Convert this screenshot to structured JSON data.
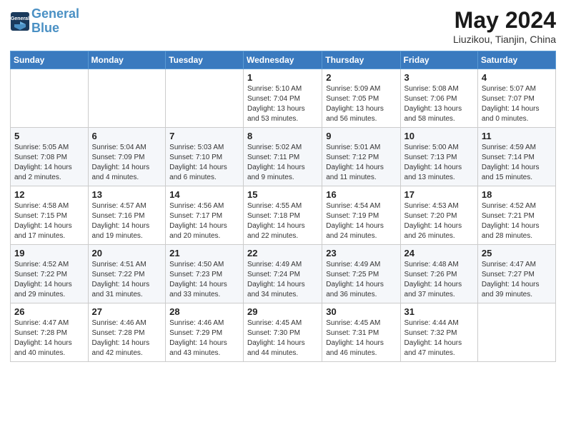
{
  "header": {
    "logo_line1": "General",
    "logo_line2": "Blue",
    "month_year": "May 2024",
    "location": "Liuzikou, Tianjin, China"
  },
  "weekdays": [
    "Sunday",
    "Monday",
    "Tuesday",
    "Wednesday",
    "Thursday",
    "Friday",
    "Saturday"
  ],
  "weeks": [
    [
      {
        "day": "",
        "info": ""
      },
      {
        "day": "",
        "info": ""
      },
      {
        "day": "",
        "info": ""
      },
      {
        "day": "1",
        "info": "Sunrise: 5:10 AM\nSunset: 7:04 PM\nDaylight: 13 hours and 53 minutes."
      },
      {
        "day": "2",
        "info": "Sunrise: 5:09 AM\nSunset: 7:05 PM\nDaylight: 13 hours and 56 minutes."
      },
      {
        "day": "3",
        "info": "Sunrise: 5:08 AM\nSunset: 7:06 PM\nDaylight: 13 hours and 58 minutes."
      },
      {
        "day": "4",
        "info": "Sunrise: 5:07 AM\nSunset: 7:07 PM\nDaylight: 14 hours and 0 minutes."
      }
    ],
    [
      {
        "day": "5",
        "info": "Sunrise: 5:05 AM\nSunset: 7:08 PM\nDaylight: 14 hours and 2 minutes."
      },
      {
        "day": "6",
        "info": "Sunrise: 5:04 AM\nSunset: 7:09 PM\nDaylight: 14 hours and 4 minutes."
      },
      {
        "day": "7",
        "info": "Sunrise: 5:03 AM\nSunset: 7:10 PM\nDaylight: 14 hours and 6 minutes."
      },
      {
        "day": "8",
        "info": "Sunrise: 5:02 AM\nSunset: 7:11 PM\nDaylight: 14 hours and 9 minutes."
      },
      {
        "day": "9",
        "info": "Sunrise: 5:01 AM\nSunset: 7:12 PM\nDaylight: 14 hours and 11 minutes."
      },
      {
        "day": "10",
        "info": "Sunrise: 5:00 AM\nSunset: 7:13 PM\nDaylight: 14 hours and 13 minutes."
      },
      {
        "day": "11",
        "info": "Sunrise: 4:59 AM\nSunset: 7:14 PM\nDaylight: 14 hours and 15 minutes."
      }
    ],
    [
      {
        "day": "12",
        "info": "Sunrise: 4:58 AM\nSunset: 7:15 PM\nDaylight: 14 hours and 17 minutes."
      },
      {
        "day": "13",
        "info": "Sunrise: 4:57 AM\nSunset: 7:16 PM\nDaylight: 14 hours and 19 minutes."
      },
      {
        "day": "14",
        "info": "Sunrise: 4:56 AM\nSunset: 7:17 PM\nDaylight: 14 hours and 20 minutes."
      },
      {
        "day": "15",
        "info": "Sunrise: 4:55 AM\nSunset: 7:18 PM\nDaylight: 14 hours and 22 minutes."
      },
      {
        "day": "16",
        "info": "Sunrise: 4:54 AM\nSunset: 7:19 PM\nDaylight: 14 hours and 24 minutes."
      },
      {
        "day": "17",
        "info": "Sunrise: 4:53 AM\nSunset: 7:20 PM\nDaylight: 14 hours and 26 minutes."
      },
      {
        "day": "18",
        "info": "Sunrise: 4:52 AM\nSunset: 7:21 PM\nDaylight: 14 hours and 28 minutes."
      }
    ],
    [
      {
        "day": "19",
        "info": "Sunrise: 4:52 AM\nSunset: 7:22 PM\nDaylight: 14 hours and 29 minutes."
      },
      {
        "day": "20",
        "info": "Sunrise: 4:51 AM\nSunset: 7:22 PM\nDaylight: 14 hours and 31 minutes."
      },
      {
        "day": "21",
        "info": "Sunrise: 4:50 AM\nSunset: 7:23 PM\nDaylight: 14 hours and 33 minutes."
      },
      {
        "day": "22",
        "info": "Sunrise: 4:49 AM\nSunset: 7:24 PM\nDaylight: 14 hours and 34 minutes."
      },
      {
        "day": "23",
        "info": "Sunrise: 4:49 AM\nSunset: 7:25 PM\nDaylight: 14 hours and 36 minutes."
      },
      {
        "day": "24",
        "info": "Sunrise: 4:48 AM\nSunset: 7:26 PM\nDaylight: 14 hours and 37 minutes."
      },
      {
        "day": "25",
        "info": "Sunrise: 4:47 AM\nSunset: 7:27 PM\nDaylight: 14 hours and 39 minutes."
      }
    ],
    [
      {
        "day": "26",
        "info": "Sunrise: 4:47 AM\nSunset: 7:28 PM\nDaylight: 14 hours and 40 minutes."
      },
      {
        "day": "27",
        "info": "Sunrise: 4:46 AM\nSunset: 7:28 PM\nDaylight: 14 hours and 42 minutes."
      },
      {
        "day": "28",
        "info": "Sunrise: 4:46 AM\nSunset: 7:29 PM\nDaylight: 14 hours and 43 minutes."
      },
      {
        "day": "29",
        "info": "Sunrise: 4:45 AM\nSunset: 7:30 PM\nDaylight: 14 hours and 44 minutes."
      },
      {
        "day": "30",
        "info": "Sunrise: 4:45 AM\nSunset: 7:31 PM\nDaylight: 14 hours and 46 minutes."
      },
      {
        "day": "31",
        "info": "Sunrise: 4:44 AM\nSunset: 7:32 PM\nDaylight: 14 hours and 47 minutes."
      },
      {
        "day": "",
        "info": ""
      }
    ]
  ]
}
